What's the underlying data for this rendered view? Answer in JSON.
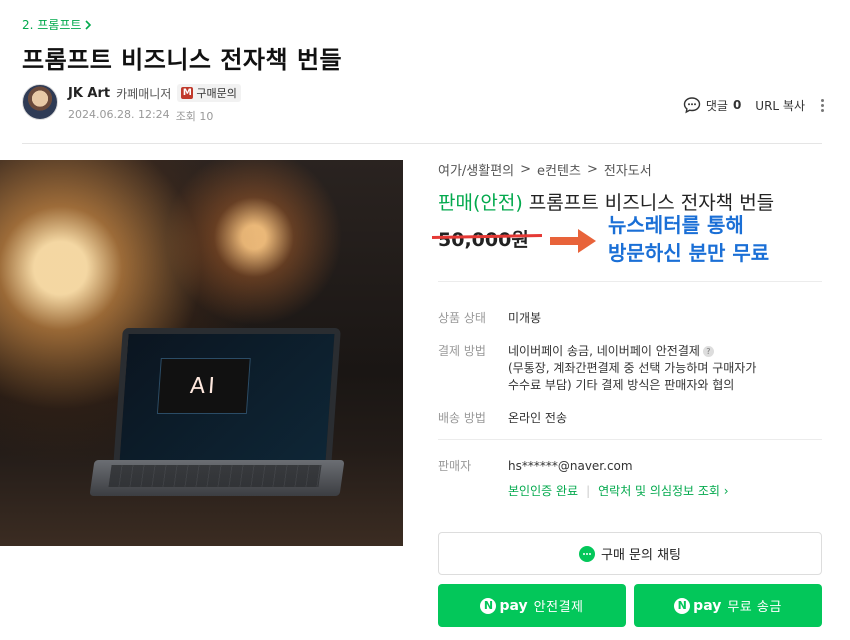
{
  "breadcrumb": {
    "label": "2. 프롬프트",
    "chevron": "chevron-right-icon"
  },
  "post": {
    "title": "프롬프트 비즈니스 전자책 번들",
    "author_name": "JK Art",
    "author_role": "카페매니저",
    "inquiry_badge_letter": "M",
    "inquiry_label": "구매문의",
    "date": "2024.06.28. 12:24",
    "views": "조회 10"
  },
  "actions": {
    "comment_label": "댓글",
    "comment_count": "0",
    "url_copy": "URL 복사"
  },
  "product": {
    "image_text": "AI",
    "category": [
      "여가/생활편의",
      "e컨텐츠",
      "전자도서"
    ],
    "category_sep": ">",
    "status_tag": "판매(안전)",
    "title": "프롬프트 비즈니스 전자책 번들",
    "price": "50,000원",
    "promo_line1": "뉴스레터를 통해",
    "promo_line2": "방문하신 분만 무료",
    "info": {
      "condition_label": "상품 상태",
      "condition_value": "미개봉",
      "payment_label": "결제 방법",
      "payment_value_1": "네이버페이 송금, 네이버페이 안전결제",
      "payment_value_2": "(무통장, 계좌간편결제 중 선택 가능하며 구매자가",
      "payment_value_3": "수수료 부담) 기타 결제 방식은 판매자와 협의",
      "shipping_label": "배송 방법",
      "shipping_value": "온라인 전송",
      "seller_label": "판매자",
      "seller_value": "hs******@naver.com",
      "verify_link": "본인인증 완료",
      "contact_link": "연락처 및 의심정보 조회"
    }
  },
  "buttons": {
    "chat_label": "구매 문의 채팅",
    "npay_mark": "N",
    "npay_text": "pay",
    "safe_pay_label": "안전결제",
    "transfer_label": "무료 송금"
  },
  "colors": {
    "brand_green": "#03c75a",
    "link_green": "#03a94d",
    "promo_blue": "#1a6fd6",
    "strike_red": "#e53935",
    "arrow_orange": "#e8633a"
  }
}
